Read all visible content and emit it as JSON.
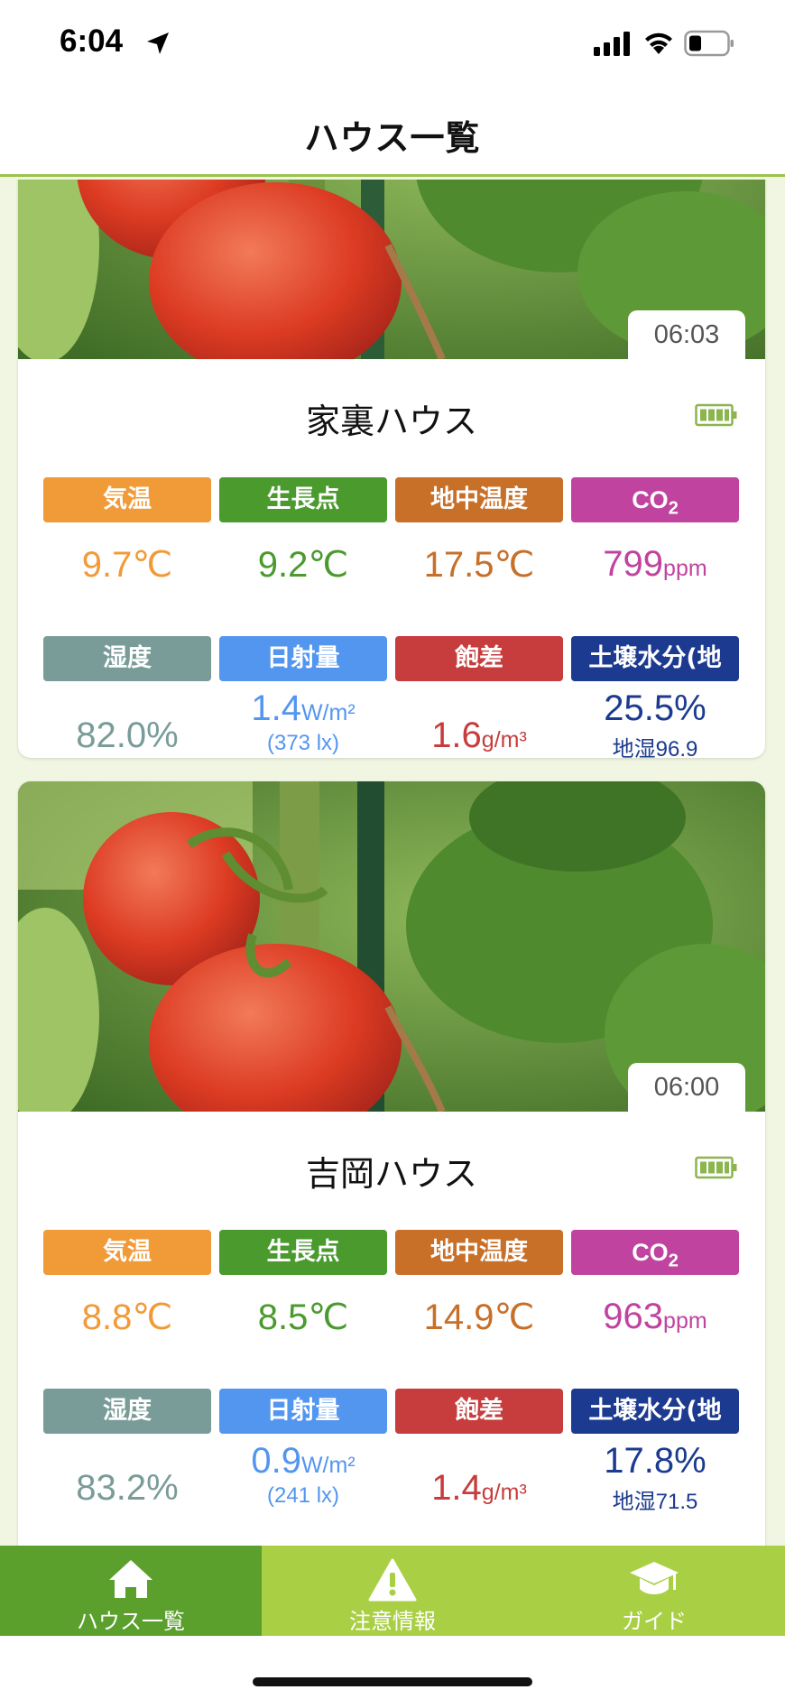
{
  "status_bar": {
    "time": "6:04"
  },
  "header": {
    "title": "ハウス一覧"
  },
  "houses": [
    {
      "time": "06:03",
      "name": "家裏ハウス",
      "labels": {
        "temp": "気温",
        "growth": "生長点",
        "soil_temp": "地中温度",
        "co2_main": "CO",
        "co2_sub": "2",
        "humidity": "湿度",
        "solar": "日射量",
        "deficit": "飽差",
        "soil_moist": "土壌水分(地"
      },
      "values": {
        "temp": "9.7",
        "temp_unit": "℃",
        "growth": "9.2",
        "growth_unit": "℃",
        "soil_temp": "17.5",
        "soil_temp_unit": "℃",
        "co2": "799",
        "co2_unit": "ppm",
        "humidity": "82.0%",
        "solar": "1.4",
        "solar_unit": "W/m²",
        "solar_lux": "(373 lx)",
        "deficit": "1.6",
        "deficit_unit": "g/m³",
        "soil_moist": "25.5%",
        "soil_moist_sub": "地湿96.9"
      }
    },
    {
      "time": "06:00",
      "name": "吉岡ハウス",
      "labels": {
        "temp": "気温",
        "growth": "生長点",
        "soil_temp": "地中温度",
        "co2_main": "CO",
        "co2_sub": "2",
        "humidity": "湿度",
        "solar": "日射量",
        "deficit": "飽差",
        "soil_moist": "土壌水分(地"
      },
      "values": {
        "temp": "8.8",
        "temp_unit": "℃",
        "growth": "8.5",
        "growth_unit": "℃",
        "soil_temp": "14.9",
        "soil_temp_unit": "℃",
        "co2": "963",
        "co2_unit": "ppm",
        "humidity": "83.2%",
        "solar": "0.9",
        "solar_unit": "W/m²",
        "solar_lux": "(241 lx)",
        "deficit": "1.4",
        "deficit_unit": "g/m³",
        "soil_moist": "17.8%",
        "soil_moist_sub": "地湿71.5"
      }
    }
  ],
  "colors": {
    "temp": "#f19a38",
    "growth": "#4a9a2e",
    "soil_temp": "#c86f28",
    "co2": "#c043a0",
    "humidity": "#7a9c99",
    "solar": "#5396f0",
    "deficit": "#c73c3c",
    "soil_moist": "#1c3a8f",
    "nav_active": "#5ba02d",
    "nav": "#a9cf45"
  },
  "nav": {
    "home": "ハウス一覧",
    "alerts": "注意情報",
    "guide": "ガイド"
  }
}
